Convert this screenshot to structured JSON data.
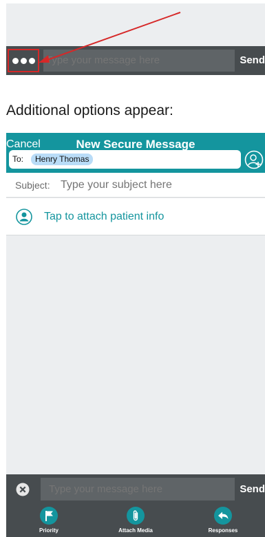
{
  "top_composer": {
    "input_placeholder": "Type your message here",
    "send_label": "Send"
  },
  "caption": "Additional options appear:",
  "header": {
    "cancel_label": "Cancel",
    "title": "New Secure Message",
    "to_label": "To:",
    "recipient": "Henry Thomas"
  },
  "subject": {
    "label": "Subject:",
    "placeholder": "Type your subject here"
  },
  "attach_patient": {
    "label": "Tap to attach patient info"
  },
  "bottom_composer": {
    "input_placeholder": "Type your message here",
    "send_label": "Send",
    "actions": [
      {
        "label": "Priority",
        "icon": "flag-icon"
      },
      {
        "label": "Attach Media",
        "icon": "paperclip-icon"
      },
      {
        "label": "Responses",
        "icon": "reply-icon"
      }
    ]
  },
  "colors": {
    "teal": "#14959e",
    "dark_bar": "#474c4f",
    "input_bg": "#5f6467",
    "highlight": "#d62828",
    "chip": "#b9dcf7"
  }
}
